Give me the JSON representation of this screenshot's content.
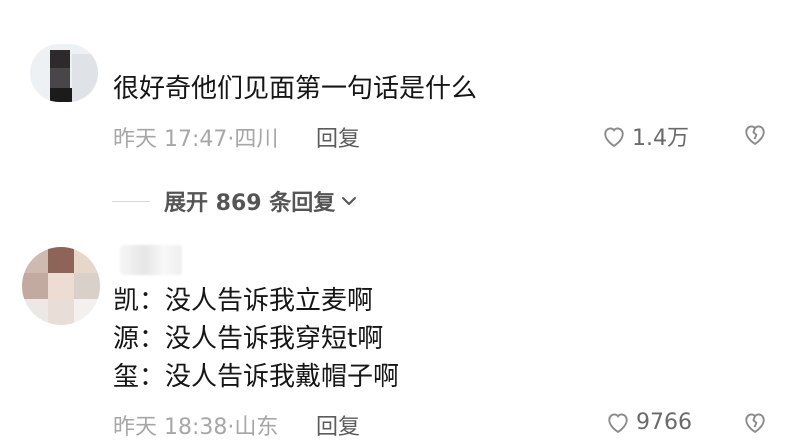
{
  "comments": [
    {
      "text_lines": [
        "很好奇他们见面第一句话是什么"
      ],
      "time_location": "昨天 17:47·四川",
      "reply_label": "回复",
      "like_count": "1.4万"
    },
    {
      "text_lines": [
        "凯：没人告诉我立麦啊",
        "源：没人告诉我穿短t啊",
        "玺：没人告诉我戴帽子啊"
      ],
      "time_location": "昨天 18:38·山东",
      "reply_label": "回复",
      "like_count": "9766"
    }
  ],
  "expand_replies": "展开 869 条回复",
  "icons": {
    "like": "heart-outline-icon",
    "dislike": "broken-heart-icon",
    "expand": "chevron-down-icon"
  },
  "colors": {
    "text": "#161616",
    "meta": "#a7a7a7",
    "reply": "#5c5c5c",
    "icon": "#8a8a8a"
  }
}
